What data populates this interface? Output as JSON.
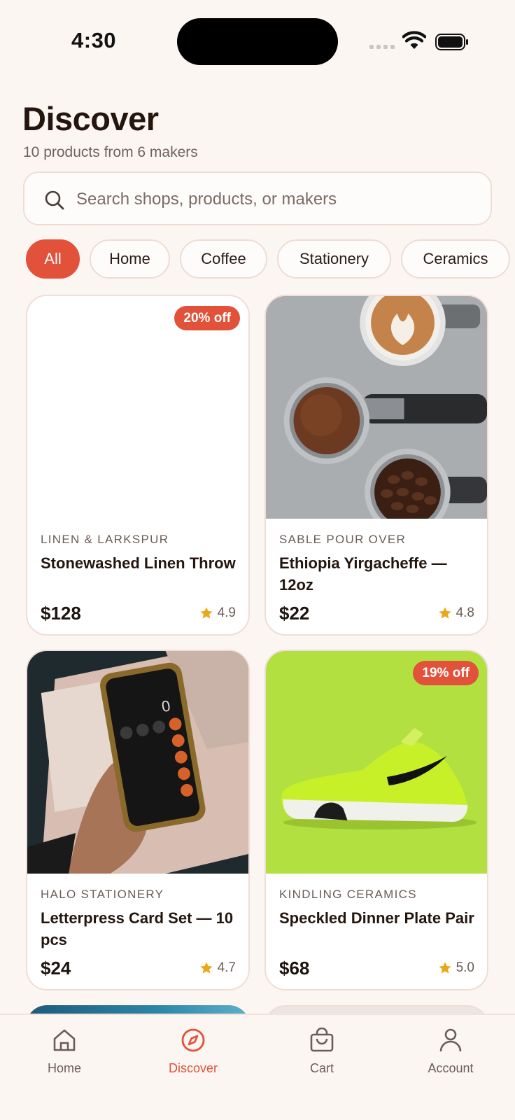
{
  "status": {
    "time": "4:30"
  },
  "header": {
    "title": "Discover",
    "subtitle": "10 products from 6 makers"
  },
  "search": {
    "placeholder": "Search shops, products, or makers",
    "value": ""
  },
  "filters": [
    {
      "label": "All",
      "active": true
    },
    {
      "label": "Home",
      "active": false
    },
    {
      "label": "Coffee",
      "active": false
    },
    {
      "label": "Stationery",
      "active": false
    },
    {
      "label": "Ceramics",
      "active": false
    }
  ],
  "products": [
    {
      "maker": "LINEN & LARKSPUR",
      "name": "Stonewashed Linen Throw",
      "price": "$128",
      "rating": "4.9",
      "badge": "20% off"
    },
    {
      "maker": "SABLE POUR OVER",
      "name": "Ethiopia Yirgacheffe — 12oz",
      "price": "$22",
      "rating": "4.8",
      "badge": ""
    },
    {
      "maker": "HALO STATIONERY",
      "name": "Letterpress Card Set — 10 pcs",
      "price": "$24",
      "rating": "4.7",
      "badge": ""
    },
    {
      "maker": "KINDLING CERAMICS",
      "name": "Speckled Dinner Plate Pair",
      "price": "$68",
      "rating": "5.0",
      "badge": "19% off"
    }
  ],
  "nav": [
    {
      "label": "Home",
      "icon": "home-icon",
      "active": false
    },
    {
      "label": "Discover",
      "icon": "compass-icon",
      "active": true
    },
    {
      "label": "Cart",
      "icon": "shopping-bag-icon",
      "active": false
    },
    {
      "label": "Account",
      "icon": "person-icon",
      "active": false
    }
  ],
  "colors": {
    "accent": "#e2513a",
    "background": "#fcf6f3",
    "star": "#e8a817"
  }
}
